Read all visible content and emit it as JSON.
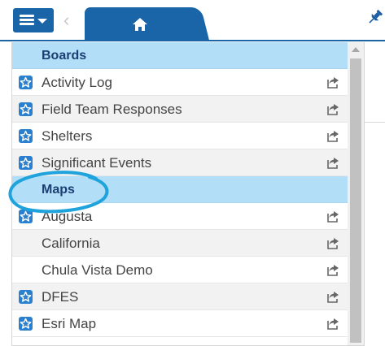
{
  "toolbar": {
    "menu_icon": "hamburger-menu-icon",
    "back_icon": "chevron-left-icon",
    "home_icon": "home-icon",
    "pin_icon": "pin-icon",
    "accent_color": "#1a64a8"
  },
  "menu": {
    "header_color": "#b3def7",
    "favorite_icon": "star-icon",
    "share_icon": "share-icon",
    "sections": [
      {
        "title": "Boards",
        "items": [
          {
            "label": "Activity Log",
            "favorite": true
          },
          {
            "label": "Field Team Responses",
            "favorite": true
          },
          {
            "label": "Shelters",
            "favorite": true
          },
          {
            "label": "Significant Events",
            "favorite": true
          }
        ]
      },
      {
        "title": "Maps",
        "highlighted": true,
        "items": [
          {
            "label": "Augusta",
            "favorite": true
          },
          {
            "label": "California",
            "favorite": false
          },
          {
            "label": "Chula Vista Demo",
            "favorite": false
          },
          {
            "label": "DFES",
            "favorite": true
          },
          {
            "label": "Esri Map",
            "favorite": true
          }
        ]
      }
    ]
  }
}
